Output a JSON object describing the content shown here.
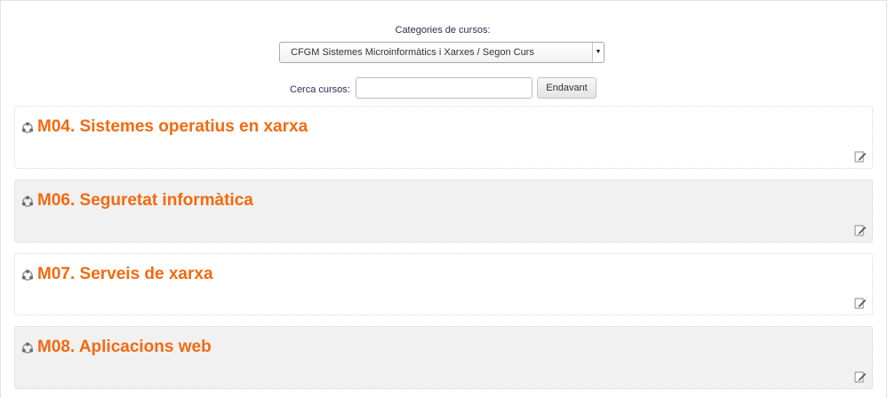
{
  "categories": {
    "label": "Categories de cursos:",
    "selected": "CFGM Sistemes Microinformàtics i Xarxes / Segon Curs"
  },
  "search": {
    "label": "Cerca cursos:",
    "value": "",
    "button_label": "Endavant"
  },
  "courses": [
    {
      "title": "M04. Sistemes operatius en xarxa",
      "icon": "course-icon",
      "action_icon": "edit-icon"
    },
    {
      "title": "M06. Seguretat informàtica",
      "icon": "course-icon",
      "action_icon": "edit-icon"
    },
    {
      "title": "M07. Serveis de xarxa",
      "icon": "course-icon",
      "action_icon": "edit-icon"
    },
    {
      "title": "M08. Aplicacions web",
      "icon": "course-icon",
      "action_icon": "edit-icon"
    }
  ],
  "colors": {
    "course_title": "#f26a0f",
    "alt_row_background": "#f1f1f1"
  }
}
